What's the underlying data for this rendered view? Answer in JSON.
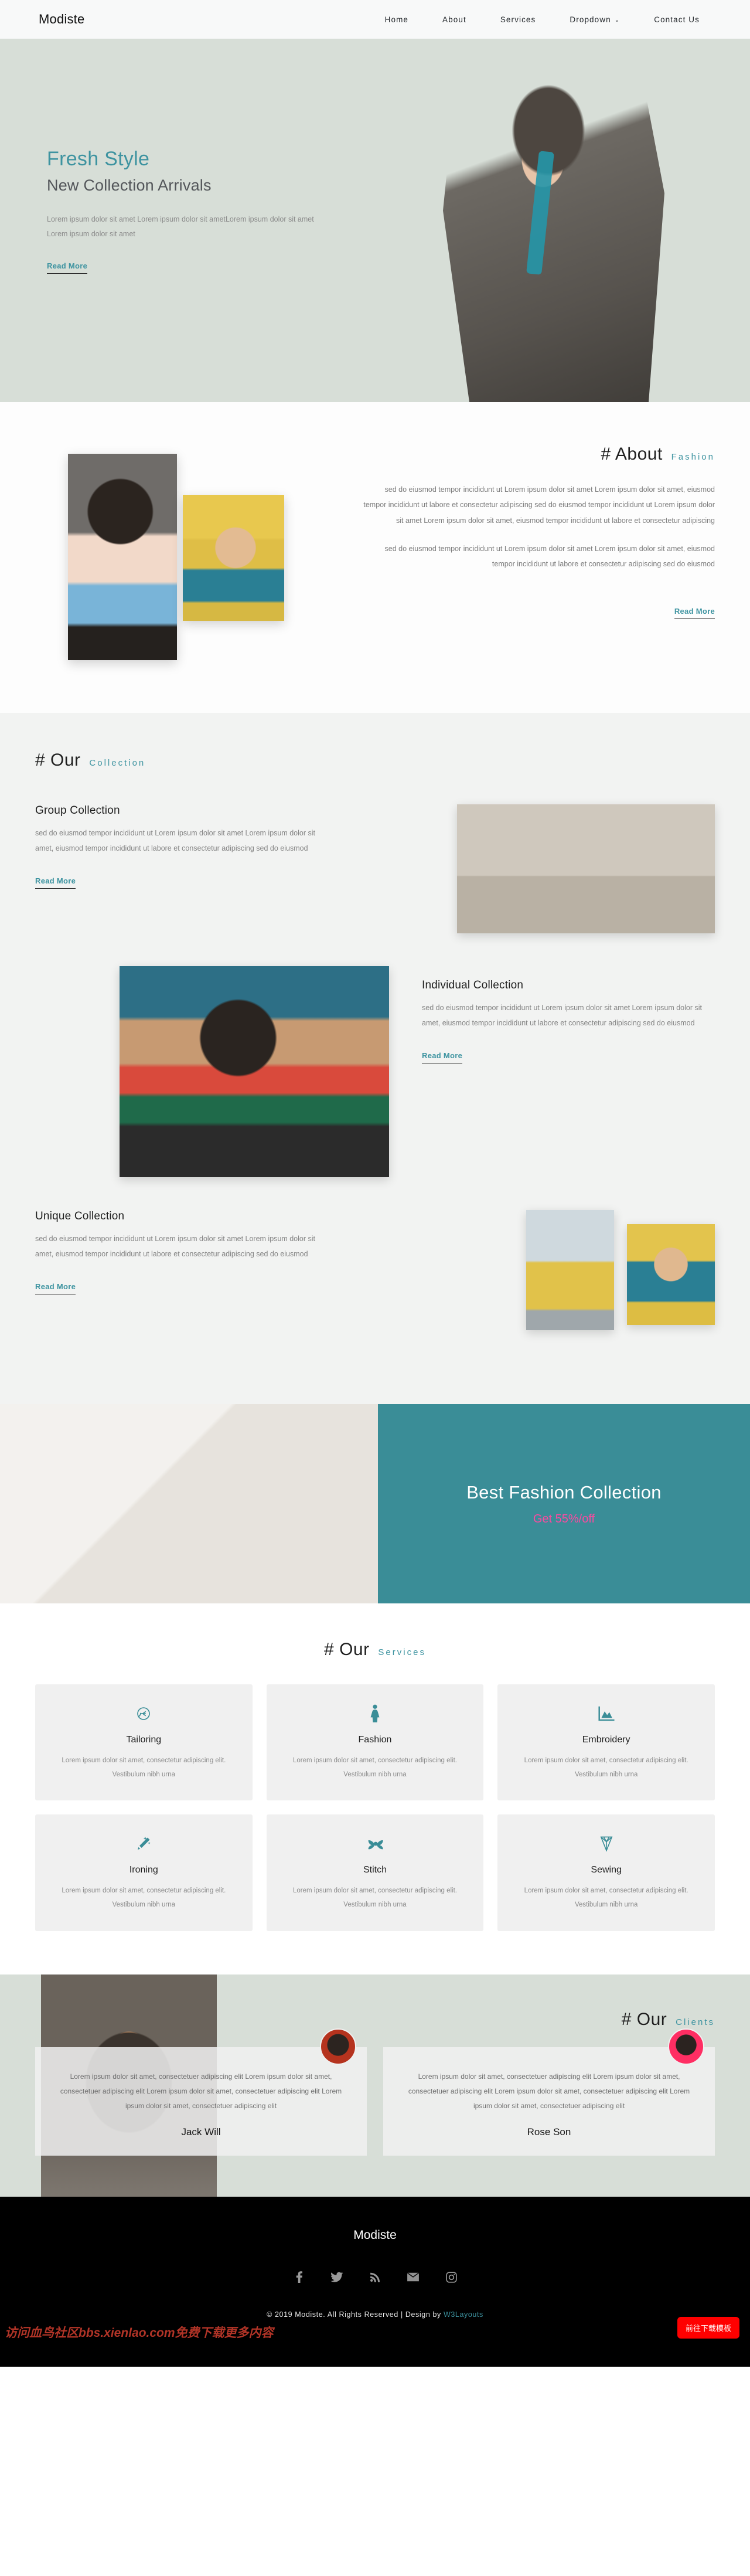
{
  "brand": "Modiste",
  "nav": {
    "items": [
      {
        "label": "Home"
      },
      {
        "label": "About"
      },
      {
        "label": "Services"
      },
      {
        "label": "Dropdown",
        "caret": "⌄"
      },
      {
        "label": "Contact Us"
      }
    ]
  },
  "hero": {
    "title": "Fresh Style",
    "subtitle": "New Collection Arrivals",
    "text": "Lorem ipsum dolor sit amet Lorem ipsum dolor sit ametLorem ipsum dolor sit amet Lorem ipsum dolor sit amet",
    "cta": "Read More"
  },
  "about": {
    "heading_hash": "#",
    "heading_main": "About",
    "heading_accent": "Fashion",
    "p1": "sed do eiusmod tempor incididunt ut Lorem ipsum dolor sit amet Lorem ipsum dolor sit amet, eiusmod tempor incididunt ut labore et consectetur adipiscing sed do eiusmod tempor incididunt ut Lorem ipsum dolor sit amet Lorem ipsum dolor sit amet, eiusmod tempor incididunt ut labore et consectetur adipiscing",
    "p2": "sed do eiusmod tempor incididunt ut Lorem ipsum dolor sit amet Lorem ipsum dolor sit amet, eiusmod tempor incididunt ut labore et consectetur adipiscing sed do eiusmod",
    "cta": "Read More"
  },
  "collection": {
    "heading_hash": "#",
    "heading_main": "Our",
    "heading_accent": "Collection",
    "items": [
      {
        "title": "Group Collection",
        "text": "sed do eiusmod tempor incididunt ut Lorem ipsum dolor sit amet Lorem ipsum dolor sit amet, eiusmod tempor incididunt ut labore et consectetur adipiscing sed do eiusmod",
        "cta": "Read More"
      },
      {
        "title": "Individual Collection",
        "text": "sed do eiusmod tempor incididunt ut Lorem ipsum dolor sit amet Lorem ipsum dolor sit amet, eiusmod tempor incididunt ut labore et consectetur adipiscing sed do eiusmod",
        "cta": "Read More"
      },
      {
        "title": "Unique Collection",
        "text": "sed do eiusmod tempor incididunt ut Lorem ipsum dolor sit amet Lorem ipsum dolor sit amet, eiusmod tempor incididunt ut labore et consectetur adipiscing sed do eiusmod",
        "cta": "Read More"
      }
    ]
  },
  "banner": {
    "title": "Best Fashion Collection",
    "subtitle": "Get 55%/off",
    "bg_color": "#3a8d97",
    "sub_color": "#fb4aa0"
  },
  "services": {
    "heading_hash": "#",
    "heading_main": "Our",
    "heading_accent": "Services",
    "cards": [
      {
        "icon": "tailoring-icon",
        "name": "Tailoring",
        "desc": "Lorem ipsum dolor sit amet, consectetur adipiscing elit. Vestibulum nibh urna"
      },
      {
        "icon": "woman-icon",
        "name": "Fashion",
        "desc": "Lorem ipsum dolor sit amet, consectetur adipiscing elit. Vestibulum nibh urna"
      },
      {
        "icon": "embroidery-icon",
        "name": "Embroidery",
        "desc": "Lorem ipsum dolor sit amet, consectetur adipiscing elit. Vestibulum nibh urna"
      },
      {
        "icon": "magic-wand-icon",
        "name": "Ironing",
        "desc": "Lorem ipsum dolor sit amet, consectetur adipiscing elit. Vestibulum nibh urna"
      },
      {
        "icon": "ribbon-icon",
        "name": "Stitch",
        "desc": "Lorem ipsum dolor sit amet, consectetur adipiscing elit. Vestibulum nibh urna"
      },
      {
        "icon": "diamond-icon",
        "name": "Sewing",
        "desc": "Lorem ipsum dolor sit amet, consectetur adipiscing elit. Vestibulum nibh urna"
      }
    ]
  },
  "clients": {
    "heading_hash": "#",
    "heading_main": "Our",
    "heading_accent": "Clients",
    "testimonials": [
      {
        "text": "Lorem ipsum dolor sit amet, consectetuer adipiscing elit Lorem ipsum dolor sit amet, consectetuer adipiscing elit Lorem ipsum dolor sit amet, consectetuer adipiscing elit Lorem ipsum dolor sit amet, consectetuer adipiscing elit",
        "name": "Jack Will"
      },
      {
        "text": "Lorem ipsum dolor sit amet, consectetuer adipiscing elit Lorem ipsum dolor sit amet, consectetuer adipiscing elit Lorem ipsum dolor sit amet, consectetuer adipiscing elit Lorem ipsum dolor sit amet, consectetuer adipiscing elit",
        "name": "Rose Son"
      }
    ]
  },
  "footer": {
    "logo": "Modiste",
    "socials": [
      {
        "name": "facebook-icon"
      },
      {
        "name": "twitter-icon"
      },
      {
        "name": "rss-icon"
      },
      {
        "name": "email-icon"
      },
      {
        "name": "instagram-icon"
      }
    ],
    "copyright_prefix": "© 2019 Modiste. All Rights Reserved | Design by ",
    "designer": "W3Layouts",
    "watermark": "访问血鸟社区bbs.xienlao.com免费下载更多内容",
    "download_button": "前往下载模板"
  }
}
